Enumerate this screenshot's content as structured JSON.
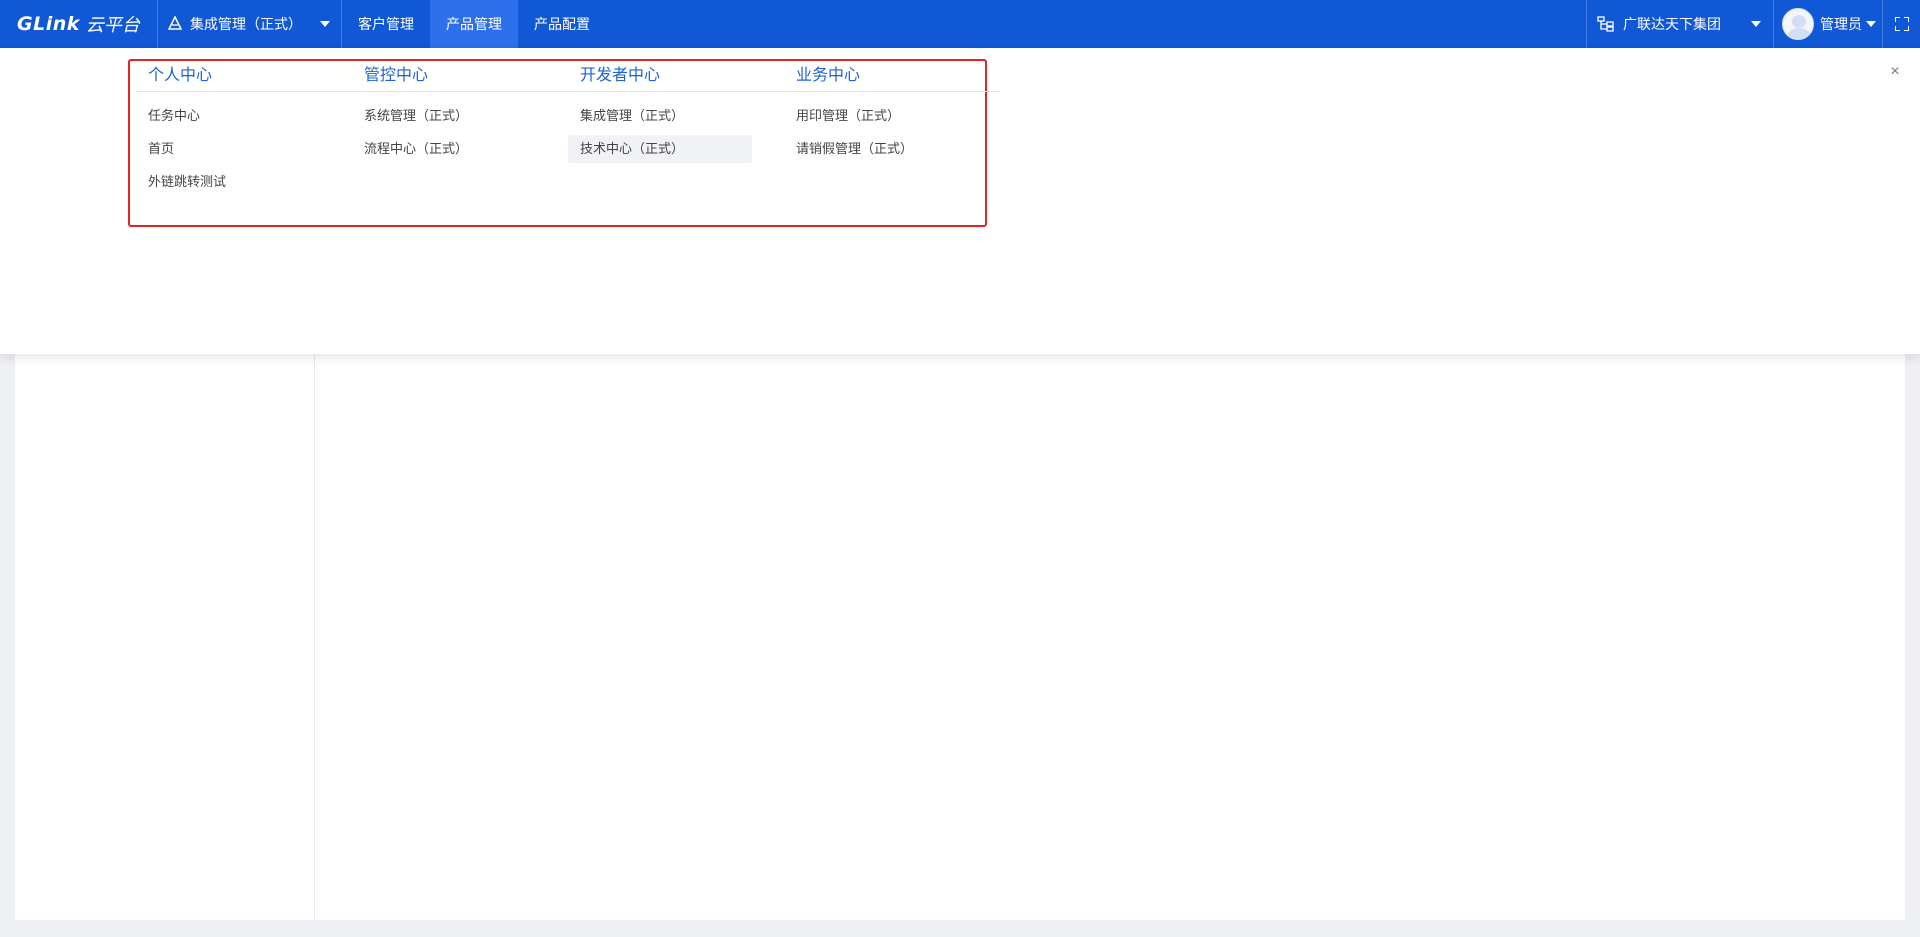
{
  "topbar": {
    "logo_brand": "GLink",
    "logo_sub": "云平台",
    "system_select": {
      "icon": "triangle-a-icon",
      "label": "集成管理（正式）"
    },
    "tabs": [
      {
        "label": "客户管理",
        "active": false
      },
      {
        "label": "产品管理",
        "active": true
      },
      {
        "label": "产品配置",
        "active": false
      }
    ],
    "org": {
      "icon": "org-tree-icon",
      "label": "广联达天下集团"
    },
    "user": {
      "label": "管理员"
    },
    "fullscreen_icon": "fullscreen-icon",
    "colors": {
      "bar": "#1158d6",
      "active_tab": "#2d70eb"
    }
  },
  "panel": {
    "close_icon": "×",
    "highlight_color": "#e02525",
    "columns": [
      {
        "title": "个人中心",
        "items": [
          "任务中心",
          "首页",
          "外链跳转测试"
        ]
      },
      {
        "title": "管控中心",
        "items": [
          "系统管理（正式）",
          "流程中心（正式）"
        ]
      },
      {
        "title": "开发者中心",
        "items": [
          "集成管理（正式）",
          "技术中心（正式）"
        ]
      },
      {
        "title": "业务中心",
        "items": [
          "用印管理（正式）",
          "请销假管理（正式）"
        ]
      }
    ],
    "hovered_item": "技术中心（正式）",
    "title_color": "#1a64d6"
  }
}
